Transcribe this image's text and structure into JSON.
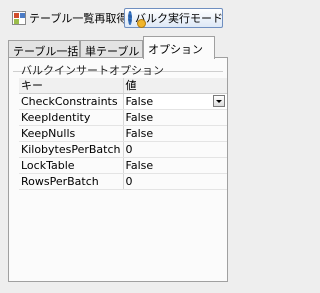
{
  "toolbar": {
    "refresh_label": "テーブル一覧再取得",
    "bulk_mode_label": "バルク実行モード",
    "refresh_icon": "table-refresh-icon",
    "bulk_icon": "gear-icon"
  },
  "tabs": [
    {
      "label": "テーブル一括"
    },
    {
      "label": "単テーブル"
    },
    {
      "label": "オプション"
    }
  ],
  "options": {
    "group_title": "バルクインサートオプション",
    "columns": {
      "key": "キー",
      "value": "値"
    },
    "rows": [
      {
        "key": "CheckConstraints",
        "value": "False"
      },
      {
        "key": "KeepIdentity",
        "value": "False"
      },
      {
        "key": "KeepNulls",
        "value": "False"
      },
      {
        "key": "KilobytesPerBatch",
        "value": "0"
      },
      {
        "key": "LockTable",
        "value": "False"
      },
      {
        "key": "RowsPerBatch",
        "value": "0"
      }
    ]
  },
  "colors": {
    "accent": "#6f8fc0",
    "background": "#eeeeee"
  }
}
